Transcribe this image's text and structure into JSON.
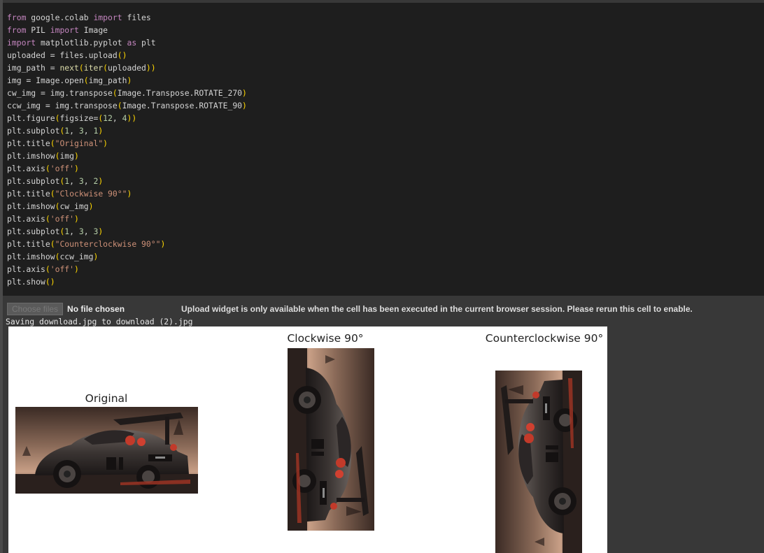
{
  "code": {
    "lines": [
      [
        {
          "t": "from",
          "c": "kw"
        },
        {
          "t": " google.colab "
        },
        {
          "t": "import",
          "c": "kw"
        },
        {
          "t": " files"
        }
      ],
      [
        {
          "t": "from",
          "c": "kw"
        },
        {
          "t": " PIL "
        },
        {
          "t": "import",
          "c": "kw"
        },
        {
          "t": " Image"
        }
      ],
      [
        {
          "t": "import",
          "c": "kw"
        },
        {
          "t": " matplotlib.pyplot "
        },
        {
          "t": "as",
          "c": "kw"
        },
        {
          "t": " plt"
        }
      ],
      [
        {
          "t": "uploaded = files.upload"
        },
        {
          "t": "()",
          "c": "br"
        }
      ],
      [
        {
          "t": "img_path = "
        },
        {
          "t": "next",
          "c": "fn"
        },
        {
          "t": "(",
          "c": "br"
        },
        {
          "t": "iter",
          "c": "fn"
        },
        {
          "t": "(",
          "c": "br"
        },
        {
          "t": "uploaded"
        },
        {
          "t": "))",
          "c": "br"
        }
      ],
      [
        {
          "t": "img = Image.open"
        },
        {
          "t": "(",
          "c": "br"
        },
        {
          "t": "img_path"
        },
        {
          "t": ")",
          "c": "br"
        }
      ],
      [
        {
          "t": "cw_img = img.transpose"
        },
        {
          "t": "(",
          "c": "br"
        },
        {
          "t": "Image.Transpose.ROTATE_270"
        },
        {
          "t": ")",
          "c": "br"
        }
      ],
      [
        {
          "t": "ccw_img = img.transpose"
        },
        {
          "t": "(",
          "c": "br"
        },
        {
          "t": "Image.Transpose.ROTATE_90"
        },
        {
          "t": ")",
          "c": "br"
        }
      ],
      [
        {
          "t": "plt.figure"
        },
        {
          "t": "(",
          "c": "br"
        },
        {
          "t": "figsize="
        },
        {
          "t": "(",
          "c": "br"
        },
        {
          "t": "12",
          "c": "num"
        },
        {
          "t": ", "
        },
        {
          "t": "4",
          "c": "num"
        },
        {
          "t": "))",
          "c": "br"
        }
      ],
      [
        {
          "t": "plt.subplot"
        },
        {
          "t": "(",
          "c": "br"
        },
        {
          "t": "1",
          "c": "num"
        },
        {
          "t": ", "
        },
        {
          "t": "3",
          "c": "num"
        },
        {
          "t": ", "
        },
        {
          "t": "1",
          "c": "num"
        },
        {
          "t": ")",
          "c": "br"
        }
      ],
      [
        {
          "t": "plt.title"
        },
        {
          "t": "(",
          "c": "br"
        },
        {
          "t": "\"Original\"",
          "c": "str"
        },
        {
          "t": ")",
          "c": "br"
        }
      ],
      [
        {
          "t": "plt.imshow"
        },
        {
          "t": "(",
          "c": "br"
        },
        {
          "t": "img"
        },
        {
          "t": ")",
          "c": "br"
        }
      ],
      [
        {
          "t": "plt.axis"
        },
        {
          "t": "(",
          "c": "br"
        },
        {
          "t": "'off'",
          "c": "str"
        },
        {
          "t": ")",
          "c": "br"
        }
      ],
      [
        {
          "t": "plt.subplot"
        },
        {
          "t": "(",
          "c": "br"
        },
        {
          "t": "1",
          "c": "num"
        },
        {
          "t": ", "
        },
        {
          "t": "3",
          "c": "num"
        },
        {
          "t": ", "
        },
        {
          "t": "2",
          "c": "num"
        },
        {
          "t": ")",
          "c": "br"
        }
      ],
      [
        {
          "t": "plt.title"
        },
        {
          "t": "(",
          "c": "br"
        },
        {
          "t": "\"Clockwise 90°\"",
          "c": "str"
        },
        {
          "t": ")",
          "c": "br"
        }
      ],
      [
        {
          "t": "plt.imshow"
        },
        {
          "t": "(",
          "c": "br"
        },
        {
          "t": "cw_img"
        },
        {
          "t": ")",
          "c": "br"
        }
      ],
      [
        {
          "t": "plt.axis"
        },
        {
          "t": "(",
          "c": "br"
        },
        {
          "t": "'off'",
          "c": "str"
        },
        {
          "t": ")",
          "c": "br"
        }
      ],
      [
        {
          "t": "plt.subplot"
        },
        {
          "t": "(",
          "c": "br"
        },
        {
          "t": "1",
          "c": "num"
        },
        {
          "t": ", "
        },
        {
          "t": "3",
          "c": "num"
        },
        {
          "t": ", "
        },
        {
          "t": "3",
          "c": "num"
        },
        {
          "t": ")",
          "c": "br"
        }
      ],
      [
        {
          "t": "plt.title"
        },
        {
          "t": "(",
          "c": "br"
        },
        {
          "t": "\"Counterclockwise 90°\"",
          "c": "str"
        },
        {
          "t": ")",
          "c": "br"
        }
      ],
      [
        {
          "t": "plt.imshow"
        },
        {
          "t": "(",
          "c": "br"
        },
        {
          "t": "ccw_img"
        },
        {
          "t": ")",
          "c": "br"
        }
      ],
      [
        {
          "t": "plt.axis"
        },
        {
          "t": "(",
          "c": "br"
        },
        {
          "t": "'off'",
          "c": "str"
        },
        {
          "t": ")",
          "c": "br"
        }
      ],
      [
        {
          "t": "plt.show"
        },
        {
          "t": "()",
          "c": "br"
        }
      ]
    ]
  },
  "upload": {
    "button_label": "Choose files",
    "no_file": "No file chosen",
    "note": "Upload widget is only available when the cell has been executed in the current browser session. Please rerun this cell to enable."
  },
  "saving_text": "Saving download.jpg to download (2).jpg",
  "figure": {
    "panels": [
      {
        "title": "Original",
        "image": "car-photo"
      },
      {
        "title": "Clockwise 90°",
        "image": "car-photo-rotated-cw"
      },
      {
        "title": "Counterclockwise 90°",
        "image": "car-photo-rotated-ccw"
      }
    ]
  },
  "colors": {
    "code_bg": "#1e1e1e",
    "output_bg": "#383838",
    "keyword": "#c586c0",
    "string": "#ce9178",
    "number": "#b5cea8",
    "bracket": "#ffd700"
  }
}
